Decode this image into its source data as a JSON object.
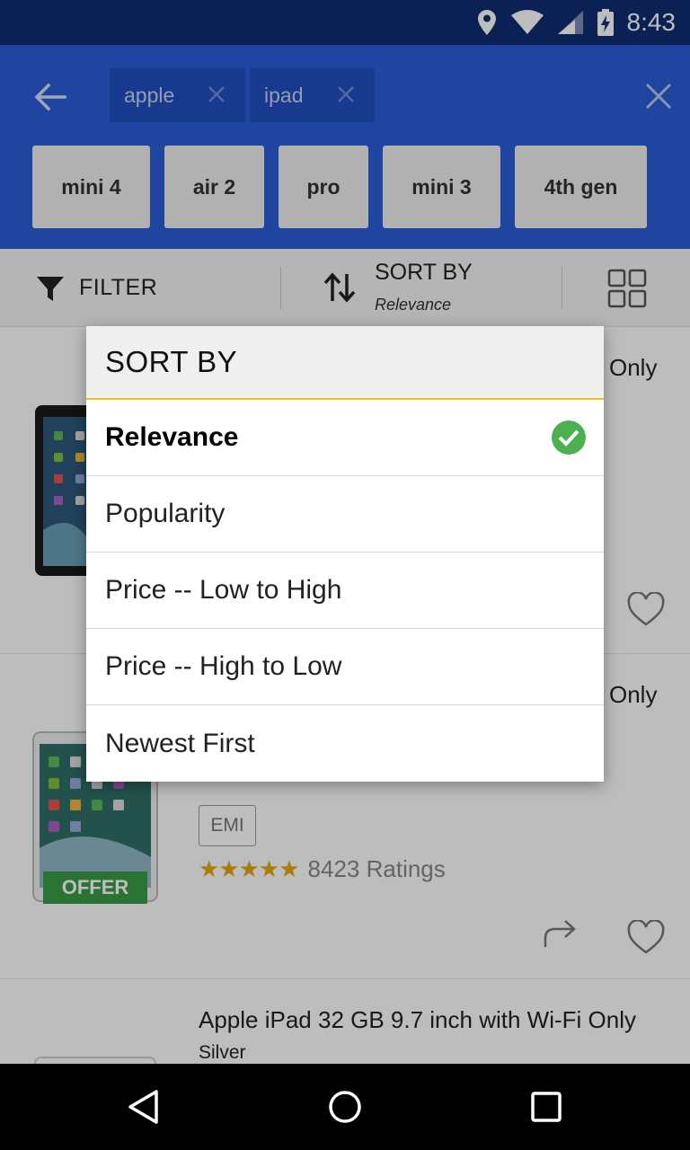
{
  "status_bar": {
    "time": "8:43",
    "icons": [
      "location-icon",
      "wifi-icon",
      "signal-icon",
      "battery-charging-icon"
    ]
  },
  "header": {
    "search_chips": [
      {
        "label": "apple"
      },
      {
        "label": "ipad"
      }
    ],
    "suggestions": [
      "mini 4",
      "air 2",
      "pro",
      "mini 3",
      "4th gen"
    ],
    "colors": {
      "header_bg": "#2b5ed9",
      "status_bg": "#0f2d72"
    }
  },
  "toolbar": {
    "filter_label": "FILTER",
    "sort_label": "SORT BY",
    "sort_value": "Relevance"
  },
  "products": [
    {
      "title_visible": "Only"
    },
    {
      "title_visible": "Only",
      "emi_label": "EMI",
      "stars": "★★★★★",
      "rating_text": "8423 Ratings",
      "badge": "OFFER"
    },
    {
      "title": "Apple iPad 32 GB 9.7 inch with Wi-Fi Only",
      "subtitle": "Silver"
    }
  ],
  "sort_dialog": {
    "title": "SORT BY",
    "options": [
      {
        "label": "Relevance",
        "selected": true
      },
      {
        "label": "Popularity",
        "selected": false
      },
      {
        "label": "Price -- Low to High",
        "selected": false
      },
      {
        "label": "Price -- High to Low",
        "selected": false
      },
      {
        "label": "Newest First",
        "selected": false
      }
    ],
    "colors": {
      "accent_underline": "#f1c21b",
      "check": "#4caf50"
    }
  },
  "nav_bar": {
    "buttons": [
      "back-triangle-icon",
      "home-circle-icon",
      "recents-square-icon"
    ]
  }
}
